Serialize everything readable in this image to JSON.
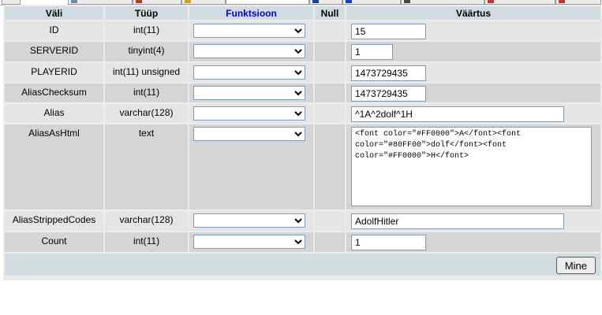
{
  "header": {
    "field": "Väli",
    "type": "Tüüp",
    "function": "Funktsioon",
    "null": "Null",
    "value": "Väärtus"
  },
  "rows": [
    {
      "name": "ID",
      "type": "int(11)",
      "value": "15"
    },
    {
      "name": "SERVERID",
      "type": "tinyint(4)",
      "value": "1"
    },
    {
      "name": "PLAYERID",
      "type": "int(11) unsigned",
      "value": "1473729435"
    },
    {
      "name": "AliasChecksum",
      "type": "int(11)",
      "value": "1473729435"
    },
    {
      "name": "Alias",
      "type": "varchar(128)",
      "value": "^1A^2dolf^1H"
    },
    {
      "name": "AliasAsHtml",
      "type": "text",
      "value": "<font color=\"#FF0000\">A</font><font color=\"#80FF00\">dolf</font><font color=\"#FF0000\">H</font>"
    },
    {
      "name": "AliasStrippedCodes",
      "type": "varchar(128)",
      "value": "AdolfHitler"
    },
    {
      "name": "Count",
      "type": "int(11)",
      "value": "1"
    }
  ],
  "footer": {
    "go_label": "Mine"
  }
}
